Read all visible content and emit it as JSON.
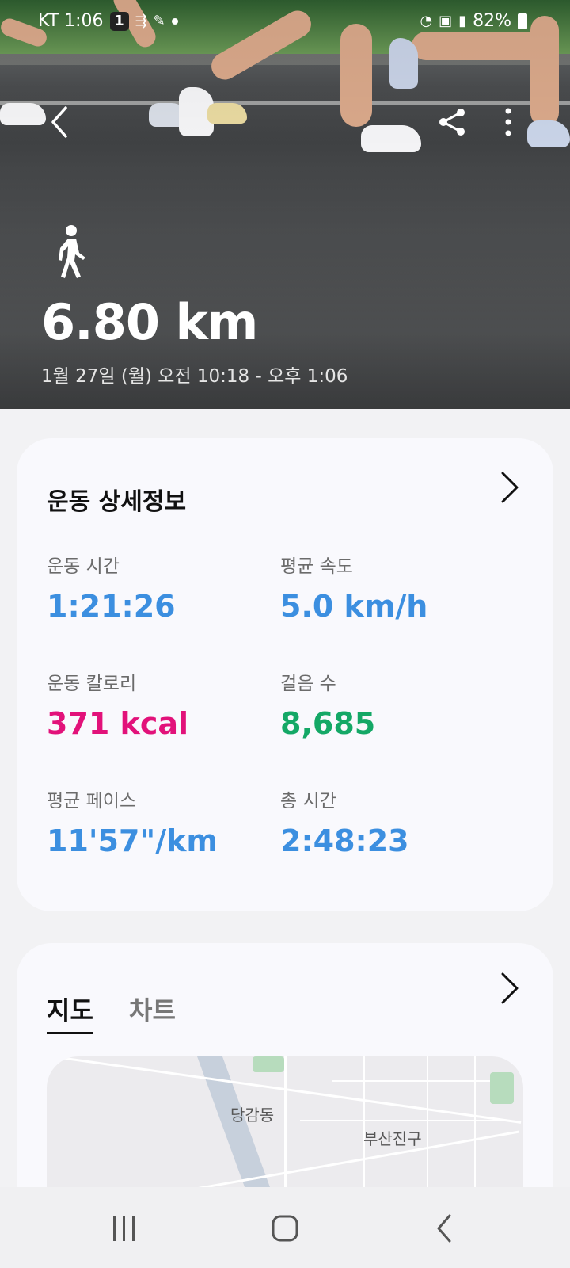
{
  "status_bar": {
    "carrier_time": "KT 1:06",
    "notification_count": "1",
    "battery": "82%"
  },
  "header": {
    "distance": "6.80 km",
    "datetime": "1월 27일 (월) 오전 10:18 - 오후 1:06",
    "activity_icon": "walking-person-icon",
    "back_icon": "chevron-left-icon",
    "share_icon": "share-icon",
    "more_icon": "more-vertical-icon"
  },
  "details": {
    "title": "운동 상세정보",
    "stats": [
      {
        "label": "운동 시간",
        "value": "1:21:26",
        "color": "#3c8fe0"
      },
      {
        "label": "평균 속도",
        "value": "5.0 km/h",
        "color": "#3c8fe0"
      },
      {
        "label": "운동 칼로리",
        "value": "371 kcal",
        "color": "#e2127a"
      },
      {
        "label": "걸음 수",
        "value": "8,685",
        "color": "#14a866"
      },
      {
        "label": "평균 페이스",
        "value": "11'57\"/km",
        "color": "#3c8fe0"
      },
      {
        "label": "총 시간",
        "value": "2:48:23",
        "color": "#3c8fe0"
      }
    ]
  },
  "map_section": {
    "tabs": [
      {
        "label": "지도",
        "active": true
      },
      {
        "label": "차트",
        "active": false
      }
    ],
    "map_labels": [
      "당감동",
      "부산진구"
    ]
  },
  "nav_bar": {
    "recent_icon": "recent-apps-icon",
    "home_icon": "home-icon",
    "back_icon": "back-icon"
  }
}
